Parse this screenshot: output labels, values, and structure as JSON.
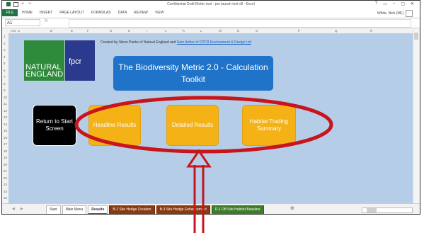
{
  "window": {
    "title": "Confidential Draft Metric tool - pre launch test v8 - Excel",
    "controls": [
      "?",
      "▭",
      "–",
      "▢",
      "✕"
    ]
  },
  "ribbon": {
    "file_label": "FILE",
    "tabs": [
      "HOME",
      "INSERT",
      "PAGE LAYOUT",
      "FORMULAS",
      "DATA",
      "REVIEW",
      "VIEW"
    ],
    "user": "White, Nick (NE)"
  },
  "formula_bar": {
    "name_box": "A1",
    "fx": "fx",
    "value": ""
  },
  "columns": [
    "A",
    "B",
    "C",
    "D",
    "E",
    "F",
    "G",
    "H",
    "I",
    "J",
    "K",
    "L",
    "M",
    "N",
    "O",
    "P",
    "Q",
    "R"
  ],
  "rows": [
    "1",
    "2",
    "3",
    "4",
    "5",
    "6",
    "7",
    "8",
    "9",
    "10",
    "11",
    "12",
    "13",
    "14",
    "15",
    "16",
    "17",
    "18",
    "19",
    "20",
    "21",
    "22",
    "23",
    "24",
    "25"
  ],
  "sheet": {
    "credit_text": "Created by Steve Panks of Natural England and",
    "credit_link": "Sam Arthur of FPCR Environment & Design Ltd",
    "logo_ne": "NATURAL ENGLAND",
    "logo_fpcr": "fpcr",
    "toolkit_title": "The Biodiversity Metric 2.0 - Calculation Toolkit",
    "buttons": {
      "return": "Return to Start Screen",
      "headline": "Headline Results",
      "detailed": "Detailed Results",
      "trading": "Habitat Trading Summary"
    }
  },
  "sheet_tabs": [
    "Start",
    "Main Menu",
    "Results",
    "B-2 Site Hedge Creation",
    "B-3 Site Hedge Enhancement",
    "D-1 Off Site Habitat Baseline"
  ],
  "active_tab": "Results",
  "colors": {
    "sheet_bg": "#b5cde6",
    "accent_yellow": "#f5b217",
    "title_blue": "#1f73c8",
    "annotation_red": "#c8151d",
    "ne_green": "#2f8b3c",
    "fpcr_navy": "#2b3a8c",
    "excel_green": "#217346"
  }
}
